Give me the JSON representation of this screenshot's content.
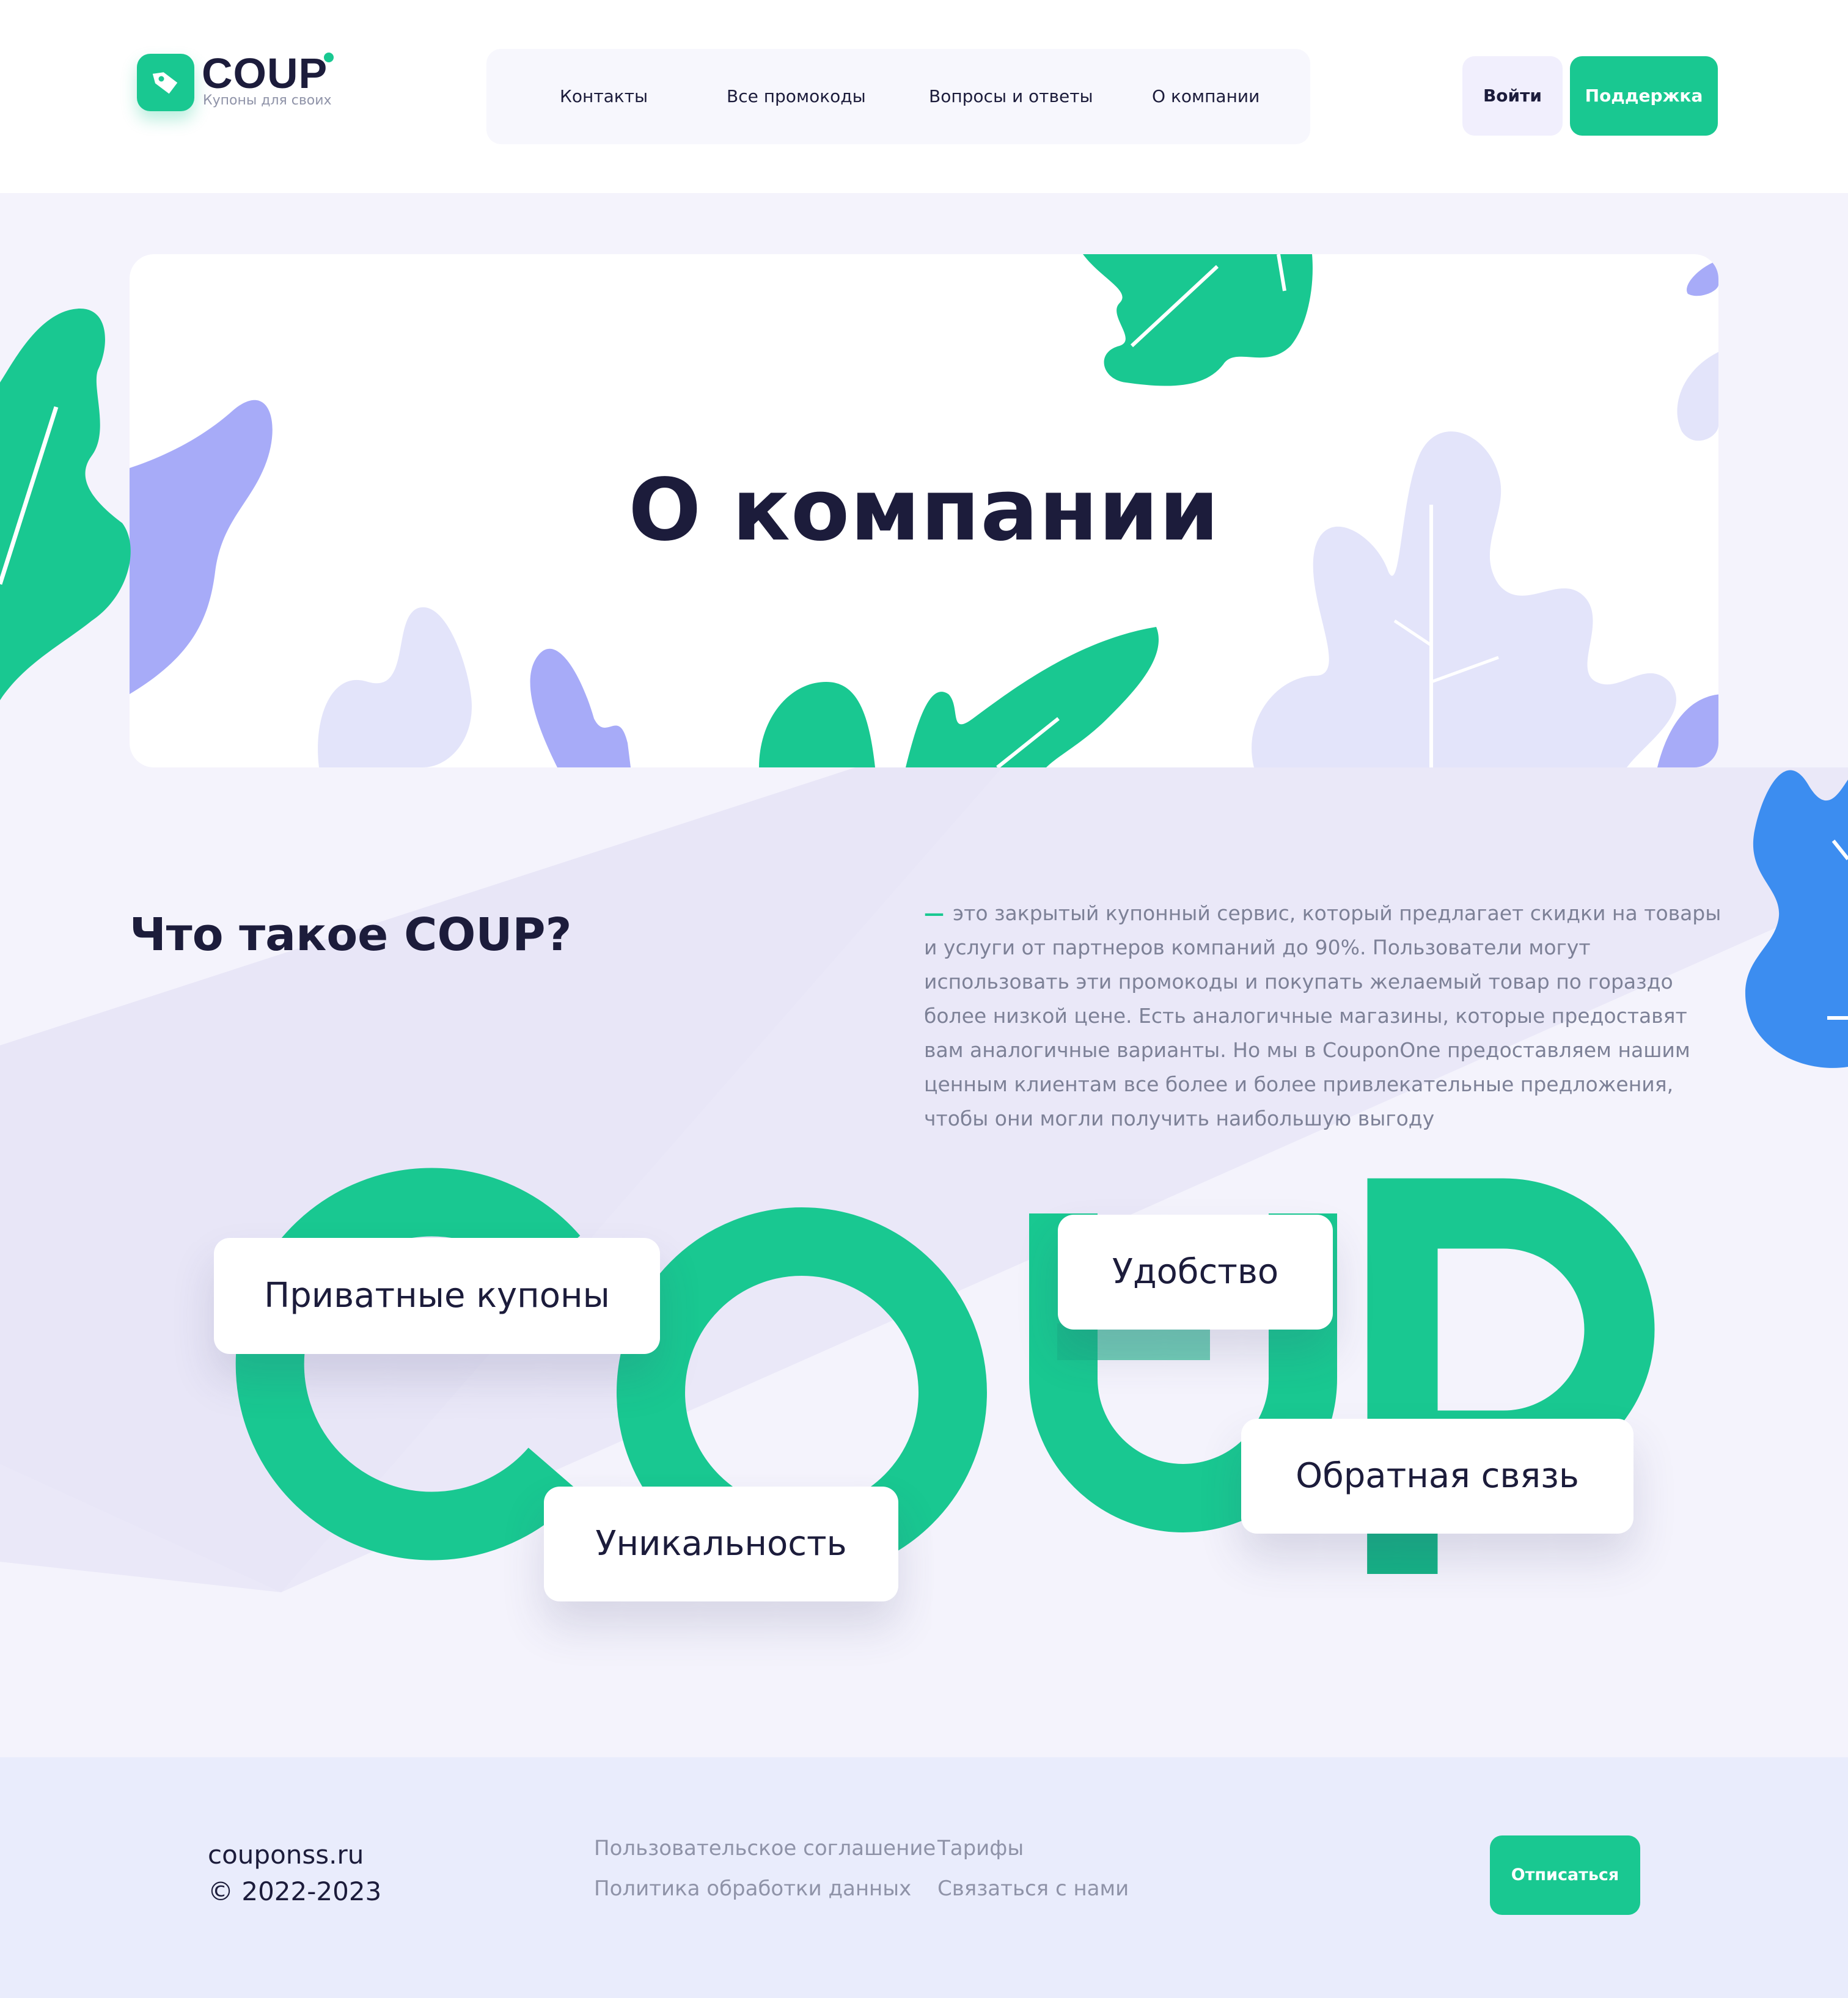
{
  "brand": {
    "name": "COUP",
    "tagline": "Купоны для своих"
  },
  "nav": {
    "items": [
      {
        "label": "Контакты"
      },
      {
        "label": "Все промокоды"
      },
      {
        "label": "Вопросы и ответы"
      },
      {
        "label": "О компании"
      }
    ]
  },
  "header_actions": {
    "login_label": "Войти",
    "support_label": "Поддержка"
  },
  "hero": {
    "title": "О компании"
  },
  "about": {
    "title": "Что такое COUP?",
    "dash": "—",
    "text": "это закрытый купонный сервис, который предлагает скидки на товары и услуги от партнеров компаний до 90%. Пользователи могут использовать эти промокоды и покупать желаемый товар по гораздо более низкой цене. Есть аналогичные магазины, которые предоставят вам аналогичные варианты. Но мы в CouponOne предоставляем нашим ценным клиентам все более и более привлекательные предложения, чтобы они могли получить наибольшую выгоду"
  },
  "features": [
    {
      "label": "Приватные купоны"
    },
    {
      "label": "Удобство"
    },
    {
      "label": "Обратная связь"
    },
    {
      "label": "Уникальность"
    }
  ],
  "footer": {
    "site": "couponss.ru",
    "copyright": "© 2022-2023",
    "links": [
      {
        "label": "Пользовательское соглашение"
      },
      {
        "label": "Тарифы"
      },
      {
        "label": "Политика обработки данных"
      },
      {
        "label": "Связаться с нами"
      }
    ],
    "unsubscribe_label": "Отписаться"
  },
  "colors": {
    "accent": "#19c891",
    "text_dark": "#1c1c3b",
    "text_muted": "#7d8197",
    "page_bg": "#f4f3fc",
    "footer_bg": "#e9ecfc",
    "leaf_purple": "#a7abf8",
    "leaf_lavender": "#e1e2fa",
    "leaf_blue": "#3c8df0"
  }
}
